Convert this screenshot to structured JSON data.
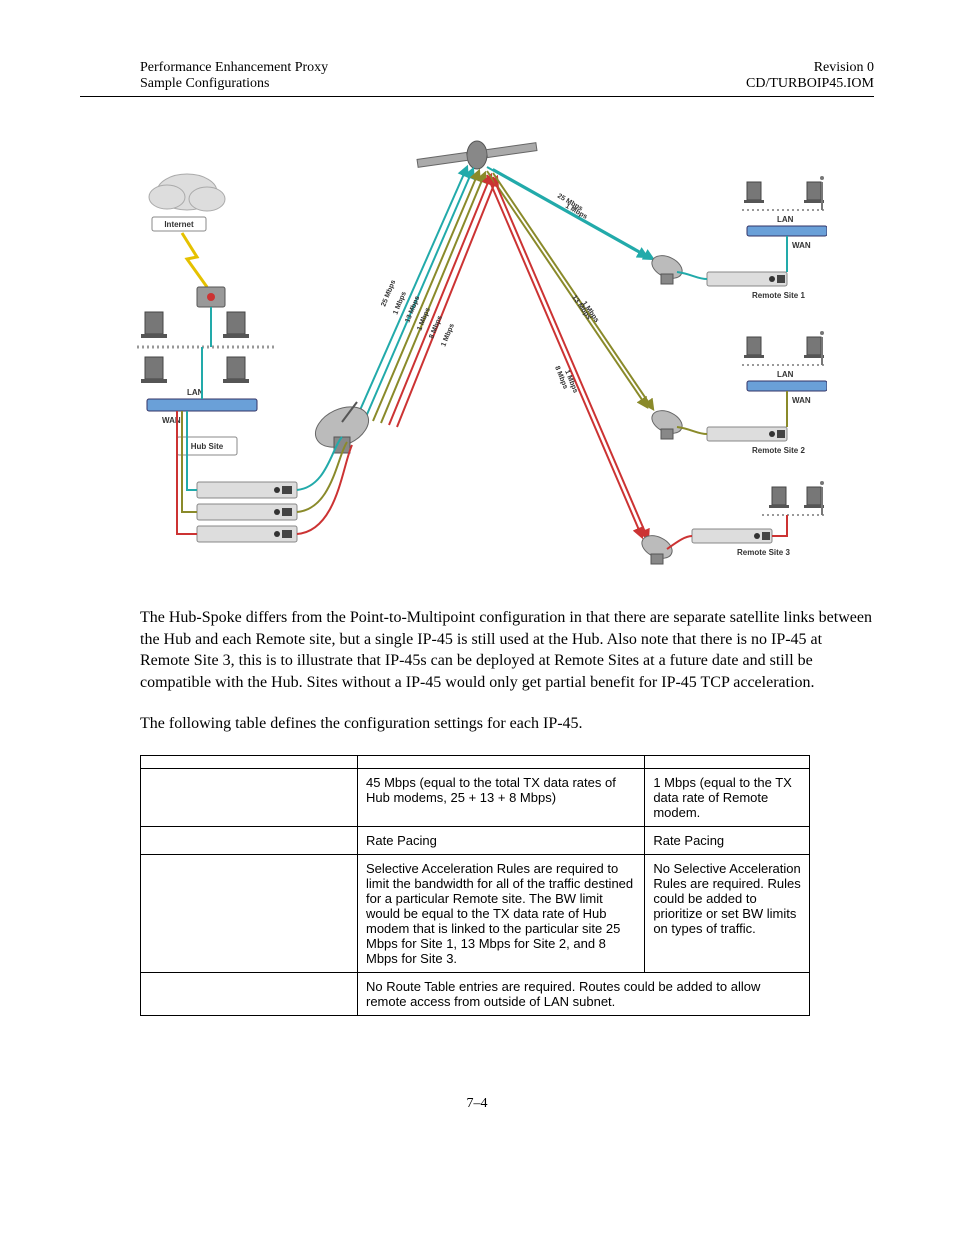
{
  "header": {
    "left1": "Performance Enhancement Proxy",
    "left2": "Sample Configurations",
    "right1": "Revision 0",
    "right2": "CD/TURBOIP45.IOM"
  },
  "diagram": {
    "internet": "Internet",
    "lan": "LAN",
    "wan": "WAN",
    "hubsite": "Hub Site",
    "remote1": "Remote Site 1",
    "remote2": "Remote Site 2",
    "remote3": "Remote Site 3",
    "bw25": "25 Mbps",
    "bw13": "13 Mbps",
    "bw8": "8 Mbps",
    "bw1": "1 Mbps"
  },
  "para1": "The Hub-Spoke differs from the Point-to-Multipoint configuration in that there are separate satellite links between the Hub and each Remote site, but a single        IP-45 is still used at the Hub. Also note that there is no        IP-45 at Remote Site 3, this is to illustrate that        IP-45s can be deployed at Remote Sites at a future date and still be compatible with the Hub. Sites without a        IP-45 would only get partial benefit for        IP-45 TCP acceleration.",
  "para2": "The following table defines the configuration settings for each        IP-45.",
  "table": {
    "r1c2": "45 Mbps (equal to the total TX data rates of Hub modems, 25 + 13 + 8 Mbps)",
    "r1c3": "1 Mbps (equal to the TX data rate of Remote modem.",
    "r2c2": "Rate Pacing",
    "r2c3": "Rate Pacing",
    "r3c2": "Selective Acceleration Rules are required to limit the bandwidth for all of the traffic destined for a particular Remote site. The BW limit would be equal to the TX data rate of Hub modem that is linked to the particular site 25 Mbps for Site 1, 13 Mbps for Site 2, and 8 Mbps for Site 3.",
    "r3c3": "No Selective Acceleration Rules are required. Rules could be added to prioritize or set BW limits on types of traffic.",
    "r4c2": "No Route Table entries are required. Routes could be added to allow remote access from outside of LAN subnet."
  },
  "pagenum": "7–4"
}
